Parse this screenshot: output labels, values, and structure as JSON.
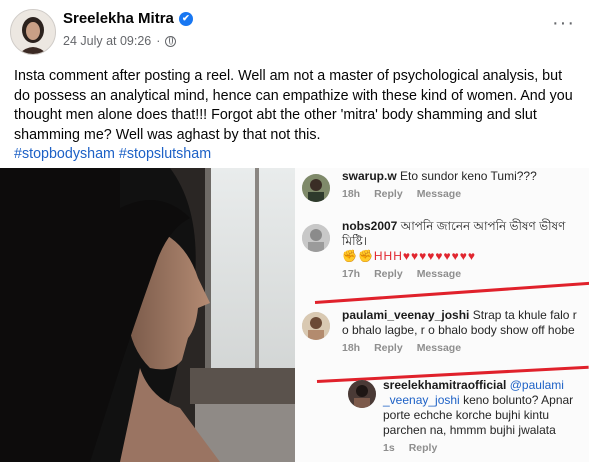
{
  "post": {
    "author": "Sreelekha Mitra",
    "verified_mark": "✔",
    "timestamp": "24 July at 09:26",
    "dot": "·",
    "menu_label": "···",
    "text": "Insta comment after posting a reel. Well am not a master of psychological analysis, but do possess an analytical mind, hence can empathize with these kind of women. And you thought men alone does that!!! Forgot abt the other 'mitra' body shamming and slut shamming me? Well was aghast by that not this.",
    "hashtags": [
      "#stopbodysham",
      "#stopslutsham"
    ]
  },
  "comments": [
    {
      "user": "swarup.w",
      "text": "Eto sundor keno Tumi???",
      "time": "18h",
      "reply": "Reply",
      "message": "Message"
    },
    {
      "user": "nobs2007",
      "text": "আপনি জানেন আপনি ভীষণ ভীষণ মিষ্টি।",
      "emoji": "✊✊HHH♥♥♥♥♥♥♥♥♥",
      "time": "17h",
      "reply": "Reply",
      "message": "Message"
    },
    {
      "user": "paulami_veenay_joshi",
      "text": "Strap ta khule falo r o bhalo lagbe, r o bhalo body show off hobe",
      "time": "18h",
      "reply": "Reply",
      "message": "Message"
    },
    {
      "user": "sreelekhamitraofficial",
      "mention": "@paulami _veenay_joshi",
      "text": "keno bolunto? Apnar porte echche korche bujhi kintu parchen na, hmmm bujhi jwalata",
      "time": "1s",
      "reply": "Reply"
    }
  ],
  "colors": {
    "link": "#1d61c6",
    "verified": "#1877f2",
    "underline": "#e0212b"
  },
  "icons": [
    "globe-icon",
    "more-options-icon",
    "verified-badge-icon"
  ]
}
